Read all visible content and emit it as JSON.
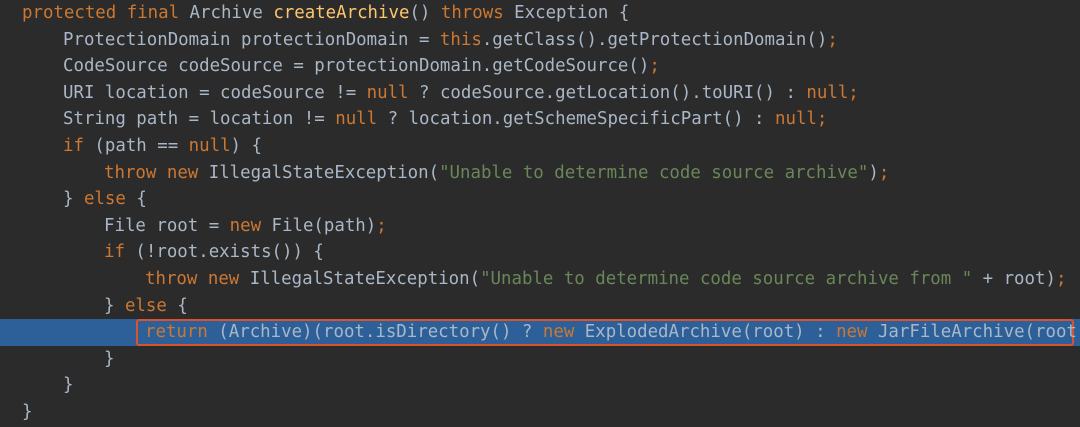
{
  "editor": {
    "lines": [
      {
        "indent": 0,
        "tokens": [
          {
            "t": "protected",
            "c": "k"
          },
          {
            "t": " ",
            "c": "d"
          },
          {
            "t": "final",
            "c": "k"
          },
          {
            "t": " Archive ",
            "c": "d"
          },
          {
            "t": "createArchive",
            "c": "f"
          },
          {
            "t": "() ",
            "c": "d"
          },
          {
            "t": "throws",
            "c": "k"
          },
          {
            "t": " Exception {",
            "c": "d"
          }
        ]
      },
      {
        "indent": 1,
        "tokens": [
          {
            "t": "ProtectionDomain protectionDomain = ",
            "c": "d"
          },
          {
            "t": "this",
            "c": "k"
          },
          {
            "t": ".getClass().getProtectionDomain()",
            "c": "d"
          },
          {
            "t": ";",
            "c": "p"
          }
        ]
      },
      {
        "indent": 1,
        "tokens": [
          {
            "t": "CodeSource codeSource = protectionDomain.getCodeSource()",
            "c": "d"
          },
          {
            "t": ";",
            "c": "p"
          }
        ]
      },
      {
        "indent": 1,
        "tokens": [
          {
            "t": "URI location = codeSource != ",
            "c": "d"
          },
          {
            "t": "null",
            "c": "k"
          },
          {
            "t": " ? codeSource.getLocation().toURI() : ",
            "c": "d"
          },
          {
            "t": "null",
            "c": "k"
          },
          {
            "t": ";",
            "c": "p"
          }
        ]
      },
      {
        "indent": 1,
        "tokens": [
          {
            "t": "String path = location != ",
            "c": "d"
          },
          {
            "t": "null",
            "c": "k"
          },
          {
            "t": " ? location.getSchemeSpecificPart() : ",
            "c": "d"
          },
          {
            "t": "null",
            "c": "k"
          },
          {
            "t": ";",
            "c": "p"
          }
        ]
      },
      {
        "indent": 1,
        "tokens": [
          {
            "t": "if",
            "c": "k"
          },
          {
            "t": " (path == ",
            "c": "d"
          },
          {
            "t": "null",
            "c": "k"
          },
          {
            "t": ") {",
            "c": "d"
          }
        ]
      },
      {
        "indent": 2,
        "tokens": [
          {
            "t": "throw",
            "c": "k"
          },
          {
            "t": " ",
            "c": "d"
          },
          {
            "t": "new",
            "c": "k"
          },
          {
            "t": " IllegalStateException(",
            "c": "d"
          },
          {
            "t": "\"Unable to determine code source archive\"",
            "c": "s"
          },
          {
            "t": ")",
            "c": "d"
          },
          {
            "t": ";",
            "c": "p"
          }
        ]
      },
      {
        "indent": 1,
        "tokens": [
          {
            "t": "} ",
            "c": "d"
          },
          {
            "t": "else",
            "c": "k"
          },
          {
            "t": " {",
            "c": "d"
          }
        ]
      },
      {
        "indent": 2,
        "tokens": [
          {
            "t": "File root = ",
            "c": "d"
          },
          {
            "t": "new",
            "c": "k"
          },
          {
            "t": " File(path)",
            "c": "d"
          },
          {
            "t": ";",
            "c": "p"
          }
        ]
      },
      {
        "indent": 2,
        "tokens": [
          {
            "t": "if",
            "c": "k"
          },
          {
            "t": " (!root.exists()) {",
            "c": "d"
          }
        ]
      },
      {
        "indent": 3,
        "tokens": [
          {
            "t": "throw",
            "c": "k"
          },
          {
            "t": " ",
            "c": "d"
          },
          {
            "t": "new",
            "c": "k"
          },
          {
            "t": " IllegalStateException(",
            "c": "d"
          },
          {
            "t": "\"Unable to determine code source archive from \"",
            "c": "s"
          },
          {
            "t": " + root)",
            "c": "d"
          },
          {
            "t": ";",
            "c": "p"
          }
        ]
      },
      {
        "indent": 2,
        "tokens": [
          {
            "t": "} ",
            "c": "d"
          },
          {
            "t": "else",
            "c": "k"
          },
          {
            "t": " {",
            "c": "d"
          }
        ]
      },
      {
        "indent": 3,
        "current": true,
        "tokens": [
          {
            "t": "return",
            "c": "k"
          },
          {
            "t": " (Archive)(root.isDirectory() ? ",
            "c": "d"
          },
          {
            "t": "new",
            "c": "k"
          },
          {
            "t": " ExplodedArchive(root) : ",
            "c": "d"
          },
          {
            "t": "new",
            "c": "k"
          },
          {
            "t": " JarFileArchive(root))",
            "c": "d"
          },
          {
            "t": ";",
            "c": "p"
          }
        ]
      },
      {
        "indent": 2,
        "tokens": [
          {
            "t": "}",
            "c": "d"
          }
        ]
      },
      {
        "indent": 1,
        "tokens": [
          {
            "t": "}",
            "c": "d"
          }
        ]
      },
      {
        "indent": 0,
        "tokens": [
          {
            "t": "}",
            "c": "d"
          }
        ]
      }
    ]
  }
}
